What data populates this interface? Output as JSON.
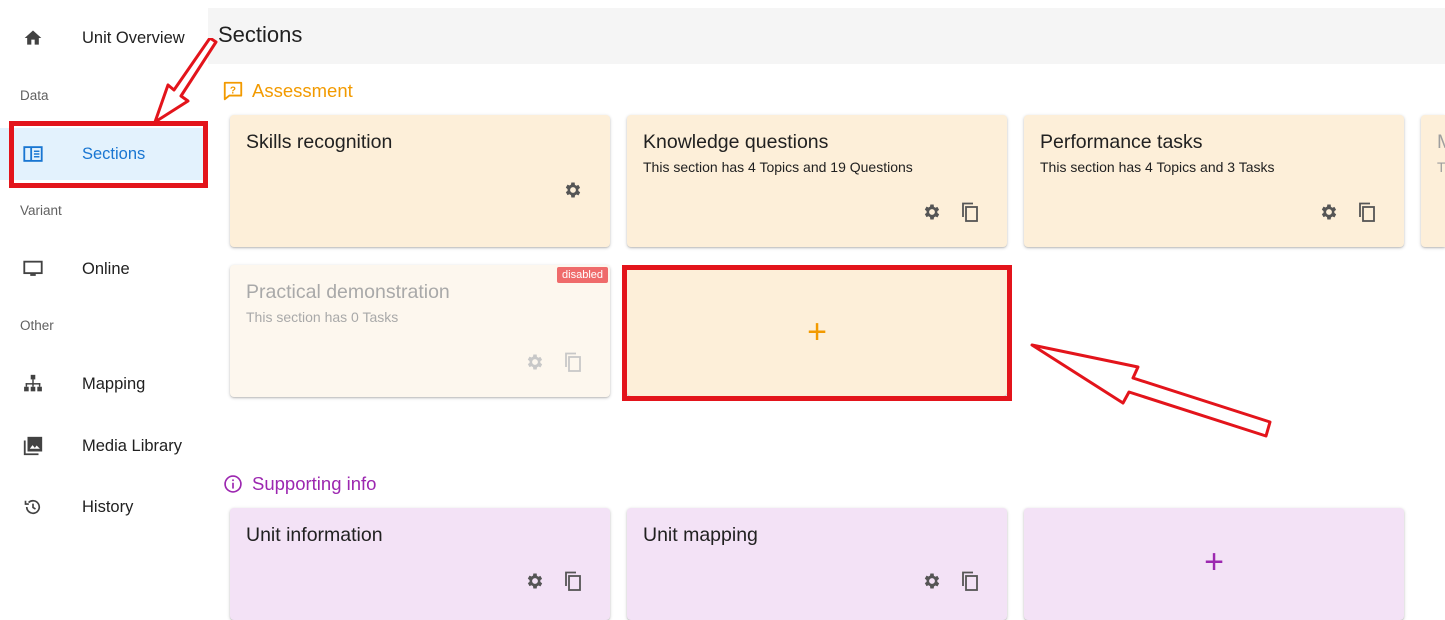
{
  "sidebar": {
    "items": [
      {
        "label": "Unit Overview",
        "icon": "home-icon"
      },
      {
        "label": "Sections",
        "icon": "sections-icon",
        "active": true
      },
      {
        "label": "Online",
        "icon": "monitor-icon"
      },
      {
        "label": "Mapping",
        "icon": "sitemap-icon"
      },
      {
        "label": "Media Library",
        "icon": "image-library-icon"
      },
      {
        "label": "History",
        "icon": "history-icon"
      }
    ],
    "groups": {
      "data": "Data",
      "variant": "Variant",
      "other": "Other"
    }
  },
  "header": {
    "title": "Sections"
  },
  "assessment": {
    "heading": "Assessment",
    "color": "#f29a00",
    "cards": [
      {
        "title": "Skills recognition",
        "subtitle": ""
      },
      {
        "title": "Knowledge questions",
        "subtitle": "This section has 4 Topics and 19 Questions"
      },
      {
        "title": "Performance tasks",
        "subtitle": "This section has 4 Topics and 3 Tasks"
      },
      {
        "title": "Practical demonstration",
        "subtitle": "This section has 0 Tasks",
        "badge": "disabled"
      }
    ],
    "add_label": "+",
    "partial_card": {
      "title": "M",
      "subtitle": "T"
    }
  },
  "supporting": {
    "heading": "Supporting info",
    "color": "#9c27b0",
    "cards": [
      {
        "title": "Unit information"
      },
      {
        "title": "Unit mapping"
      }
    ],
    "add_label": "+"
  },
  "colors": {
    "active_nav_bg": "#e3f2fd",
    "active_nav_text": "#1976d2",
    "annotation_red": "#e3141b"
  }
}
